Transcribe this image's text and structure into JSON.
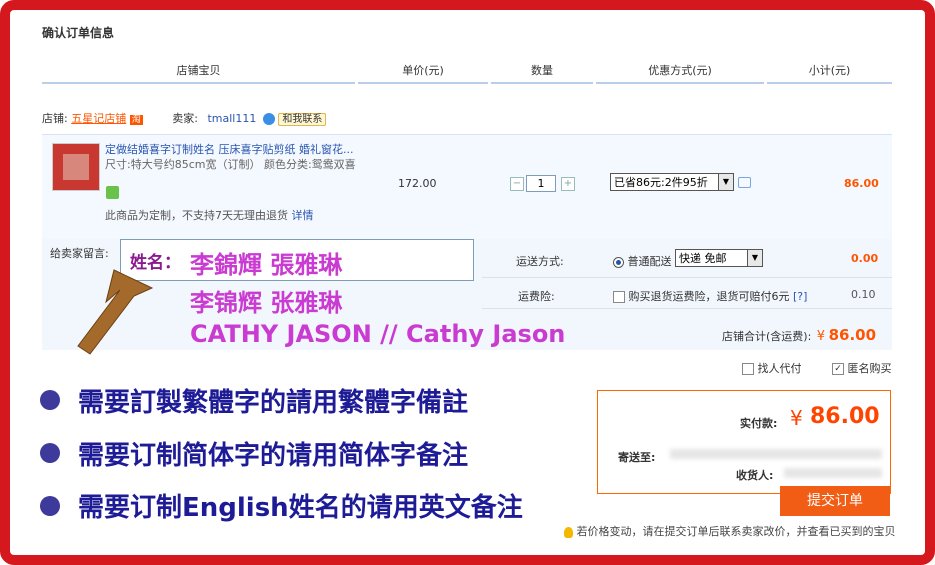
{
  "title": "确认订单信息",
  "headers": [
    "店铺宝贝",
    "单价(元)",
    "数量",
    "优惠方式(元)",
    "小计(元)"
  ],
  "shop": {
    "shop_label": "店铺:",
    "shop_name": "五星记店铺",
    "shop_badge": "淘",
    "seller_label": "卖家:",
    "seller_name": "tmall111",
    "contact_label": "和我联系"
  },
  "item": {
    "title": "定做结婚喜字订制姓名 压床喜字贴剪纸 婚礼窗花...",
    "spec": "尺寸:特大号约85cm宽（订制）  颜色分类:鸳鸯双喜",
    "notice": "此商品为定制，不支持7天无理由退货",
    "detail_link": "详情",
    "price": "172.00",
    "qty": "1",
    "qty_minus": "−",
    "qty_plus": "+",
    "discount": "已省86元:2件95折",
    "subtotal": "86.00"
  },
  "message": {
    "label": "给卖家留言:",
    "name_prefix": "姓名：",
    "line1": "李錦輝  張雅琳",
    "line2": "李锦辉  张雅琳",
    "line3": "CATHY   JASON  //  Cathy  Jason"
  },
  "shipping": {
    "label": "运送方式:",
    "option": "普通配送",
    "select": "快递 免邮",
    "fee": "0.00",
    "insurance_label": "运费险:",
    "insurance_text": "购买退货运费险，退货可赔付6元",
    "insurance_help": "[?]",
    "insurance_fee": "0.10",
    "total_label": "店铺合计(含运费):",
    "currency": "¥",
    "total": "86.00"
  },
  "options": {
    "proxy_pay": "找人代付",
    "anonymous": "匿名购买"
  },
  "bullets": [
    "需要訂製繁體字的請用繁體字備註",
    "需要订制简体字的请用简体字备注",
    "需要订制English姓名的请用英文备注"
  ],
  "payment": {
    "label": "实付款:",
    "currency": "¥",
    "amount": "86.00",
    "ship_to_label": "寄送至:",
    "receiver_label": "收货人:"
  },
  "submit_label": "提交订单",
  "footer_note": "若价格变动，请在提交订单后联系卖家改价，并查看已买到的宝贝",
  "colors": {
    "frame": "#d4181d",
    "accent": "#ff5500",
    "overlay": "#c93bd1",
    "bullet": "#1d1b96"
  }
}
